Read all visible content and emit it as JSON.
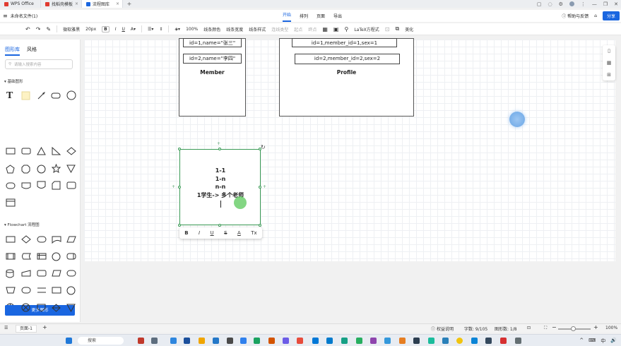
{
  "titlebar": {
    "tabs": [
      {
        "label": "WPS Office",
        "color": "#e03a2f"
      },
      {
        "label": "找稻壳模板",
        "color": "#e03a2f"
      },
      {
        "label": "流程图库",
        "color": "#1a66e0"
      }
    ],
    "add_tab": "+"
  },
  "menubar": {
    "file_name": "未命名文件(1)",
    "menus": [
      "开始",
      "排列",
      "页面",
      "导出"
    ],
    "active_menu": "开始",
    "help": "帮助与反馈",
    "share": "分享"
  },
  "toolbar": {
    "undo": "↶",
    "redo": "↷",
    "font": "微软雅黑",
    "font_size": "20px",
    "bold": "B",
    "italic": "I",
    "underline": "U",
    "zoom": "100%",
    "line_color": "线条颜色",
    "line_width": "线条宽度",
    "line_style": "线条样式",
    "connector": "连线类型",
    "start": "起点",
    "end": "终点",
    "latex": "LaTeX方程式",
    "beautify": "美化"
  },
  "leftpanel": {
    "tabs": [
      "图形库",
      "风格"
    ],
    "active_tab": "图形库",
    "search_placeholder": "请输入搜索内容",
    "section_basic": "基础图形",
    "section_flowchart": "Flowchart 流程图",
    "more_shapes": "更多图形"
  },
  "canvas": {
    "member": {
      "rows": [
        "id=1,name=\"张三\"",
        "id=2,name=\"李四\""
      ],
      "title": "Member"
    },
    "profile": {
      "rows": [
        "id=1,member_id=1,sex=1",
        "id=2,member_id=2,sex=2"
      ],
      "title": "Profile"
    },
    "selected_text_lines": [
      "1-1",
      "1-n",
      "n-n",
      "1学生-> 多个老师"
    ],
    "format_bar": [
      "B",
      "I",
      "U",
      "S",
      "A",
      "Tx"
    ]
  },
  "statusbar": {
    "page": "页面-1",
    "add_page": "+",
    "permission": "权益说明",
    "char_count": "字数: 9/105",
    "shape_count": "图形数: 1/8",
    "zoom_minus": "−",
    "zoom_plus": "+",
    "zoom": "100%"
  },
  "taskbar": {
    "search": "搜索",
    "tray": [
      "^",
      "⌨",
      "中",
      "🔊"
    ]
  }
}
